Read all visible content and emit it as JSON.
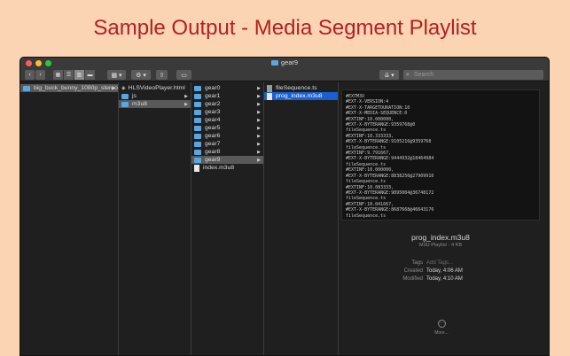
{
  "headline": "Sample Output - Media Segment Playlist",
  "window": {
    "title": "gear9"
  },
  "toolbar": {
    "back_glyph": "‹",
    "forward_glyph": "›",
    "search_placeholder": "Search",
    "dropbox_glyph": "⇊"
  },
  "col1": {
    "items": [
      {
        "label": "big_buck_bunny_1080p_stereo"
      }
    ]
  },
  "col2": {
    "items": [
      {
        "label": "HLSVideoPlayer.html"
      },
      {
        "label": "js"
      },
      {
        "label": "m3u8"
      }
    ]
  },
  "col3": {
    "folders": [
      {
        "label": "gear0"
      },
      {
        "label": "gear1"
      },
      {
        "label": "gear2"
      },
      {
        "label": "gear3"
      },
      {
        "label": "gear4"
      },
      {
        "label": "gear5"
      },
      {
        "label": "gear6"
      },
      {
        "label": "gear7"
      },
      {
        "label": "gear8"
      },
      {
        "label": "gear9"
      }
    ],
    "file": "index.m3u8"
  },
  "col4": {
    "items": [
      {
        "label": "fileSequence.ts"
      },
      {
        "label": "prog_index.m3u8"
      }
    ]
  },
  "preview": {
    "lines": [
      "#EXTM3U",
      "#EXT-X-VERSION:4",
      "#EXT-X-TARGETDURATION:10",
      "#EXT-X-MEDIA-SEQUENCE:0",
      "#EXTINF:10.000000,",
      "#EXT-X-BYTERANGE:9359768@0",
      "fileSequence.ts",
      "#EXTINF:10.333333,",
      "#EXT-X-BYTERANGE:9105216@9359768",
      "fileSequence.ts",
      "#EXTINF:9.791667,",
      "#EXT-X-BYTERANGE:9444932@18464984",
      "fileSequence.ts",
      "#EXTINF:10.000000,",
      "#EXT-X-BYTERANGE:8838256@27909916",
      "fileSequence.ts",
      "#EXTINF:10.083333,",
      "#EXT-X-BYTERANGE:9895004@36748172",
      "fileSequence.ts",
      "#EXTINF:10.041667,",
      "#EXT-X-BYTERANGE:8687668@46643176",
      "fileSequence.ts"
    ]
  },
  "info": {
    "name": "prog_index.m3u8",
    "type": "M3U Playlist - 4 KB",
    "tags_label": "Tags",
    "tags_placeholder": "Add Tags...",
    "created_label": "Created",
    "created_value": "Today, 4:06 AM",
    "modified_label": "Modified",
    "modified_value": "Today, 4:10 AM",
    "more_label": "More..."
  },
  "colors": {
    "headline": "#b32020",
    "selection": "#1a5fcf",
    "folder": "#5aa6e0"
  }
}
